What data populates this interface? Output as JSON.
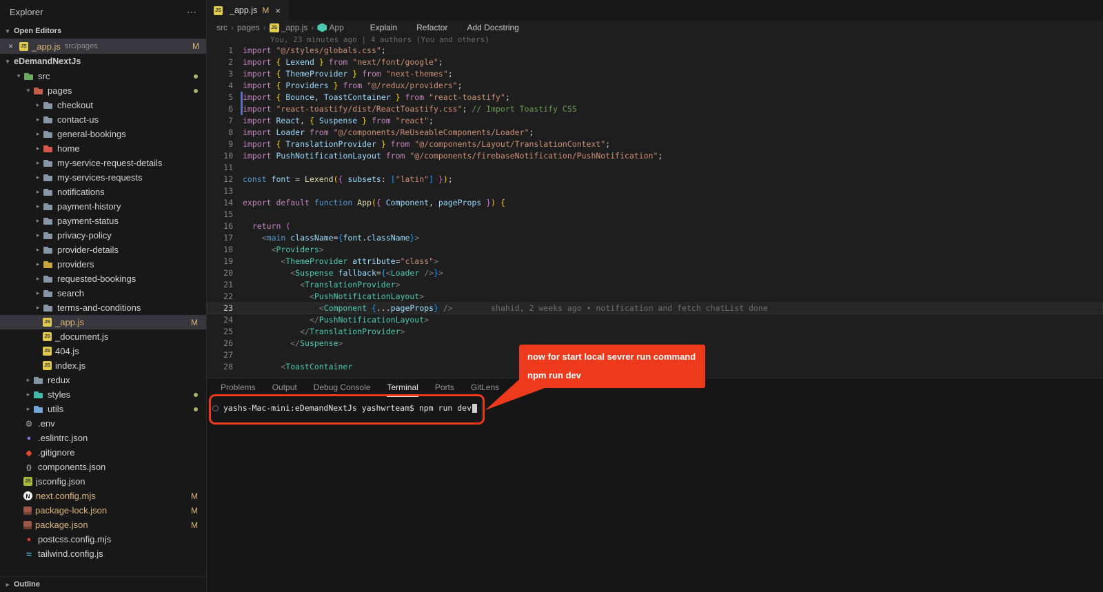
{
  "colors": {
    "modified_badge": "#dcb67a",
    "annotation_red": "#ee3a1c",
    "selection_bg": "#37373d",
    "editor_bg": "#1e1e1e",
    "sidebar_bg": "#181818"
  },
  "icons": {
    "close": "×",
    "more": "⋯",
    "crumb_separator": "›",
    "chevron_down": "▾",
    "chevron_right": "▸"
  },
  "sidebar": {
    "title": "Explorer",
    "open_editors": {
      "header": "Open Editors",
      "items": [
        {
          "icon": "js",
          "label": "_app.js",
          "path": "src/pages",
          "badge": "M",
          "selected": true
        }
      ]
    },
    "workspace": {
      "header": "eDemandNextJs"
    },
    "outline_header": "Outline",
    "tree": [
      {
        "label": "src",
        "icon": "folder",
        "color": "#6cab5d",
        "indent": 1,
        "expanded": true,
        "dot": true
      },
      {
        "label": "pages",
        "icon": "folder",
        "color": "#c65f4a",
        "indent": 2,
        "expanded": true,
        "dot": true
      },
      {
        "label": "checkout",
        "icon": "folder",
        "color": "#8796a5",
        "indent": 3,
        "expanded": false
      },
      {
        "label": "contact-us",
        "icon": "folder",
        "color": "#8796a5",
        "indent": 3,
        "expanded": false
      },
      {
        "label": "general-bookings",
        "icon": "folder",
        "color": "#8796a5",
        "indent": 3,
        "expanded": false
      },
      {
        "label": "home",
        "icon": "folder",
        "color": "#d4574e",
        "indent": 3,
        "expanded": false
      },
      {
        "label": "my-service-request-details",
        "icon": "folder",
        "color": "#8796a5",
        "indent": 3,
        "expanded": false
      },
      {
        "label": "my-services-requests",
        "icon": "folder",
        "color": "#8796a5",
        "indent": 3,
        "expanded": false
      },
      {
        "label": "notifications",
        "icon": "folder",
        "color": "#8796a5",
        "indent": 3,
        "expanded": false
      },
      {
        "label": "payment-history",
        "icon": "folder",
        "color": "#8796a5",
        "indent": 3,
        "expanded": false
      },
      {
        "label": "payment-status",
        "icon": "folder",
        "color": "#8796a5",
        "indent": 3,
        "expanded": false
      },
      {
        "label": "privacy-policy",
        "icon": "folder",
        "color": "#8796a5",
        "indent": 3,
        "expanded": false
      },
      {
        "label": "provider-details",
        "icon": "folder",
        "color": "#8796a5",
        "indent": 3,
        "expanded": false
      },
      {
        "label": "providers",
        "icon": "folder",
        "color": "#c9a33b",
        "indent": 3,
        "expanded": false
      },
      {
        "label": "requested-bookings",
        "icon": "folder",
        "color": "#8796a5",
        "indent": 3,
        "expanded": false
      },
      {
        "label": "search",
        "icon": "folder",
        "color": "#8796a5",
        "indent": 3,
        "expanded": false
      },
      {
        "label": "terms-and-conditions",
        "icon": "folder",
        "color": "#8796a5",
        "indent": 3,
        "expanded": false
      },
      {
        "label": "_app.js",
        "icon": "js",
        "indent": 3,
        "badge": "M",
        "selected": true
      },
      {
        "label": "_document.js",
        "icon": "js",
        "indent": 3
      },
      {
        "label": "404.js",
        "icon": "js",
        "indent": 3
      },
      {
        "label": "index.js",
        "icon": "js",
        "indent": 3
      },
      {
        "label": "redux",
        "icon": "folder",
        "color": "#8796a5",
        "indent": 2,
        "expanded": false
      },
      {
        "label": "styles",
        "icon": "folder",
        "color": "#45b8ab",
        "indent": 2,
        "expanded": false,
        "dot": true
      },
      {
        "label": "utils",
        "icon": "folder",
        "color": "#74a7d4",
        "indent": 2,
        "expanded": false,
        "dot": true
      },
      {
        "label": ".env",
        "icon": "env",
        "indent": 1
      },
      {
        "label": ".eslintrc.json",
        "icon": "eslint",
        "indent": 1
      },
      {
        "label": ".gitignore",
        "icon": "git",
        "indent": 1
      },
      {
        "label": "components.json",
        "icon": "braces",
        "indent": 1
      },
      {
        "label": "jsconfig.json",
        "icon": "jsconfig",
        "indent": 1
      },
      {
        "label": "next.config.mjs",
        "icon": "next",
        "indent": 1,
        "badge": "M"
      },
      {
        "label": "package-lock.json",
        "icon": "npm",
        "indent": 1,
        "badge": "M"
      },
      {
        "label": "package.json",
        "icon": "npm",
        "indent": 1,
        "badge": "M"
      },
      {
        "label": "postcss.config.mjs",
        "icon": "postcss",
        "indent": 1
      },
      {
        "label": "tailwind.config.js",
        "icon": "tailwind",
        "indent": 1
      }
    ]
  },
  "editor": {
    "tab": {
      "icon": "js",
      "name": "_app.js",
      "badge": "M"
    },
    "breadcrumbs": [
      {
        "label": "src"
      },
      {
        "label": "pages"
      },
      {
        "label": "_app.js",
        "icon": "js"
      },
      {
        "label": "App",
        "icon": "hex"
      }
    ],
    "lens_actions": [
      "Explain",
      "Refactor",
      "Add Docstring"
    ],
    "blame_header": "You, 23 minutes ago | 4 authors (You and others)",
    "lines": [
      {
        "n": 1,
        "t": [
          [
            "k",
            "import "
          ],
          [
            "s",
            "\"@/styles/globals.css\""
          ],
          [
            "p",
            ";"
          ]
        ]
      },
      {
        "n": 2,
        "t": [
          [
            "k",
            "import "
          ],
          [
            "g",
            "{ "
          ],
          [
            "v",
            "Lexend"
          ],
          [
            "g",
            " }"
          ],
          [
            "k",
            " from "
          ],
          [
            "s",
            "\"next/font/google\""
          ],
          [
            "p",
            ";"
          ]
        ]
      },
      {
        "n": 3,
        "t": [
          [
            "k",
            "import "
          ],
          [
            "g",
            "{ "
          ],
          [
            "v",
            "ThemeProvider"
          ],
          [
            "g",
            " }"
          ],
          [
            "k",
            " from "
          ],
          [
            "s",
            "\"next-themes\""
          ],
          [
            "p",
            ";"
          ]
        ]
      },
      {
        "n": 4,
        "t": [
          [
            "k",
            "import "
          ],
          [
            "g",
            "{ "
          ],
          [
            "v",
            "Providers"
          ],
          [
            "g",
            " }"
          ],
          [
            "k",
            " from "
          ],
          [
            "s",
            "\"@/redux/providers\""
          ],
          [
            "p",
            ";"
          ]
        ]
      },
      {
        "n": 5,
        "mark": true,
        "t": [
          [
            "k",
            "import "
          ],
          [
            "g",
            "{ "
          ],
          [
            "v",
            "Bounce"
          ],
          [
            "p",
            ", "
          ],
          [
            "v",
            "ToastContainer"
          ],
          [
            "g",
            " }"
          ],
          [
            "k",
            " from "
          ],
          [
            "s",
            "\"react-toastify\""
          ],
          [
            "p",
            ";"
          ]
        ]
      },
      {
        "n": 6,
        "mark": true,
        "t": [
          [
            "k",
            "import "
          ],
          [
            "s",
            "\"react-toastify/dist/ReactToastify.css\""
          ],
          [
            "p",
            "; "
          ],
          [
            "c",
            "// Import Toastify CSS"
          ]
        ]
      },
      {
        "n": 7,
        "t": [
          [
            "k",
            "import "
          ],
          [
            "v",
            "React"
          ],
          [
            "p",
            ", "
          ],
          [
            "g",
            "{ "
          ],
          [
            "v",
            "Suspense"
          ],
          [
            "g",
            " }"
          ],
          [
            "k",
            " from "
          ],
          [
            "s",
            "\"react\""
          ],
          [
            "p",
            ";"
          ]
        ]
      },
      {
        "n": 8,
        "t": [
          [
            "k",
            "import "
          ],
          [
            "v",
            "Loader"
          ],
          [
            "k",
            " from "
          ],
          [
            "s",
            "\"@/components/ReUseableComponents/Loader\""
          ],
          [
            "p",
            ";"
          ]
        ]
      },
      {
        "n": 9,
        "t": [
          [
            "k",
            "import "
          ],
          [
            "g",
            "{ "
          ],
          [
            "v",
            "TranslationProvider"
          ],
          [
            "g",
            " }"
          ],
          [
            "k",
            " from "
          ],
          [
            "s",
            "\"@/components/Layout/TranslationContext\""
          ],
          [
            "p",
            ";"
          ]
        ]
      },
      {
        "n": 10,
        "t": [
          [
            "k",
            "import "
          ],
          [
            "v",
            "PushNotificationLayout"
          ],
          [
            "k",
            " from "
          ],
          [
            "s",
            "\"@/components/firebaseNotification/PushNotification\""
          ],
          [
            "p",
            ";"
          ]
        ]
      },
      {
        "n": 11,
        "t": []
      },
      {
        "n": 12,
        "t": [
          [
            "b",
            "const "
          ],
          [
            "v",
            "font"
          ],
          [
            "p",
            " = "
          ],
          [
            "f",
            "Lexend"
          ],
          [
            "g",
            "("
          ],
          [
            "m",
            "{ "
          ],
          [
            "v",
            "subsets"
          ],
          [
            "p",
            ": "
          ],
          [
            "u",
            "["
          ],
          [
            "s",
            "\"latin\""
          ],
          [
            "u",
            "]"
          ],
          [
            "m",
            " }"
          ],
          [
            "g",
            ")"
          ],
          [
            "p",
            ";"
          ]
        ]
      },
      {
        "n": 13,
        "t": []
      },
      {
        "n": 14,
        "t": [
          [
            "k",
            "export default "
          ],
          [
            "b",
            "function "
          ],
          [
            "f",
            "App"
          ],
          [
            "g",
            "("
          ],
          [
            "m",
            "{ "
          ],
          [
            "v",
            "Component"
          ],
          [
            "p",
            ", "
          ],
          [
            "v",
            "pageProps"
          ],
          [
            "m",
            " }"
          ],
          [
            "g",
            ")"
          ],
          [
            "p",
            " "
          ],
          [
            "g",
            "{"
          ]
        ]
      },
      {
        "n": 15,
        "t": []
      },
      {
        "n": 16,
        "t": [
          [
            "w",
            "  "
          ],
          [
            "k",
            "return "
          ],
          [
            "m",
            "("
          ]
        ]
      },
      {
        "n": 17,
        "t": [
          [
            "w",
            "    "
          ],
          [
            "a",
            "<"
          ],
          [
            "b",
            "main"
          ],
          [
            "w",
            " "
          ],
          [
            "v",
            "className"
          ],
          [
            "p",
            "="
          ],
          [
            "u",
            "{"
          ],
          [
            "v",
            "font"
          ],
          [
            "p",
            "."
          ],
          [
            "v",
            "className"
          ],
          [
            "u",
            "}"
          ],
          [
            "a",
            ">"
          ]
        ]
      },
      {
        "n": 18,
        "t": [
          [
            "w",
            "      "
          ],
          [
            "a",
            "<"
          ],
          [
            "t",
            "Providers"
          ],
          [
            "a",
            ">"
          ]
        ]
      },
      {
        "n": 19,
        "t": [
          [
            "w",
            "        "
          ],
          [
            "a",
            "<"
          ],
          [
            "t",
            "ThemeProvider"
          ],
          [
            "w",
            " "
          ],
          [
            "v",
            "attribute"
          ],
          [
            "p",
            "="
          ],
          [
            "s",
            "\"class\""
          ],
          [
            "a",
            ">"
          ]
        ]
      },
      {
        "n": 20,
        "t": [
          [
            "w",
            "          "
          ],
          [
            "a",
            "<"
          ],
          [
            "t",
            "Suspense"
          ],
          [
            "w",
            " "
          ],
          [
            "v",
            "fallback"
          ],
          [
            "p",
            "="
          ],
          [
            "u",
            "{"
          ],
          [
            "a",
            "<"
          ],
          [
            "t",
            "Loader"
          ],
          [
            "a",
            " />"
          ],
          [
            "u",
            "}"
          ],
          [
            "a",
            ">"
          ]
        ]
      },
      {
        "n": 21,
        "t": [
          [
            "w",
            "            "
          ],
          [
            "a",
            "<"
          ],
          [
            "t",
            "TranslationProvider"
          ],
          [
            "a",
            ">"
          ]
        ]
      },
      {
        "n": 22,
        "t": [
          [
            "w",
            "              "
          ],
          [
            "a",
            "<"
          ],
          [
            "t",
            "PushNotificationLayout"
          ],
          [
            "a",
            ">"
          ]
        ]
      },
      {
        "n": 23,
        "current": true,
        "t": [
          [
            "w",
            "                "
          ],
          [
            "a",
            "<"
          ],
          [
            "t",
            "Component"
          ],
          [
            "w",
            " "
          ],
          [
            "u",
            "{"
          ],
          [
            "p",
            "..."
          ],
          [
            "v",
            "pageProps"
          ],
          [
            "u",
            "}"
          ],
          [
            "a",
            " />"
          ],
          [
            "bl",
            "        shahid, 2 weeks ago • notification and fetch chatList done"
          ]
        ]
      },
      {
        "n": 24,
        "t": [
          [
            "w",
            "              "
          ],
          [
            "a",
            "</"
          ],
          [
            "t",
            "PushNotificationLayout"
          ],
          [
            "a",
            ">"
          ]
        ]
      },
      {
        "n": 25,
        "t": [
          [
            "w",
            "            "
          ],
          [
            "a",
            "</"
          ],
          [
            "t",
            "TranslationProvider"
          ],
          [
            "a",
            ">"
          ]
        ]
      },
      {
        "n": 26,
        "t": [
          [
            "w",
            "          "
          ],
          [
            "a",
            "</"
          ],
          [
            "t",
            "Suspense"
          ],
          [
            "a",
            ">"
          ]
        ]
      },
      {
        "n": 27,
        "t": []
      },
      {
        "n": 28,
        "t": [
          [
            "w",
            "        "
          ],
          [
            "a",
            "<"
          ],
          [
            "t",
            "ToastContainer"
          ]
        ]
      }
    ]
  },
  "panel": {
    "tabs": [
      {
        "label": "Problems"
      },
      {
        "label": "Output"
      },
      {
        "label": "Debug Console"
      },
      {
        "label": "Terminal",
        "active": true
      },
      {
        "label": "Ports"
      },
      {
        "label": "GitLens"
      }
    ],
    "terminal": {
      "command": "yashs-Mac-mini:eDemandNextJs yashwrteam$ npm run dev"
    }
  },
  "annotation": {
    "line1": "now for start local sevrer run command",
    "line2": "npm run dev"
  }
}
